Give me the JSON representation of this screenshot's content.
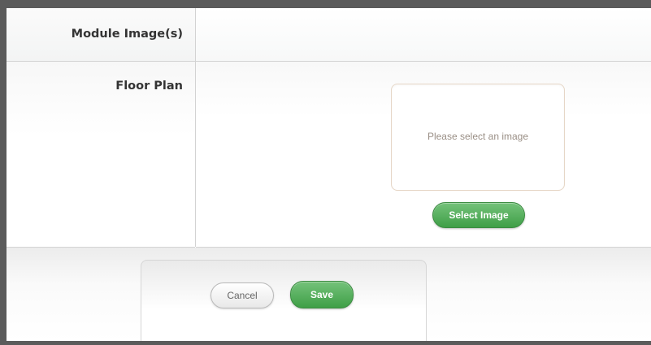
{
  "form": {
    "module_images_label": "Module Image(s)",
    "floor_plan_label": "Floor Plan",
    "image_placeholder": "Please select an image",
    "select_image_button": "Select Image"
  },
  "actions": {
    "cancel_label": "Cancel",
    "save_label": "Save"
  },
  "colors": {
    "accent_green": "#4caf50",
    "frame_gray": "#5b5b5b",
    "placeholder_text": "#9a8f86"
  }
}
